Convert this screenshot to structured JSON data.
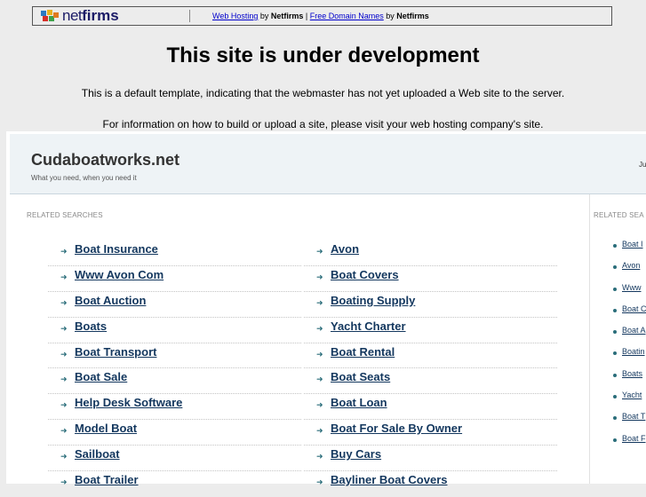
{
  "banner": {
    "logo_text_a": "net",
    "logo_text_b": "firms",
    "links": [
      {
        "link": "Web Hosting",
        "by": " by ",
        "brand": "Netfirms"
      },
      {
        "sep": " | "
      },
      {
        "link": "Free Domain Names",
        "by": " by ",
        "brand": "Netfirms"
      }
    ]
  },
  "page": {
    "title": "This site is under development",
    "notice1": "This is a default template, indicating that the webmaster has not yet uploaded a Web site to the server.",
    "notice2": "For information on how to build or upload a site, please visit your web hosting company's site."
  },
  "parked": {
    "site_name": "Cudaboatworks.net",
    "tagline": "What you need, when you need it",
    "header_right": "Ju",
    "related_label": "RELATED SEARCHES",
    "side_label": "RELATED SEA",
    "left_links": [
      "Boat Insurance",
      "Www Avon Com",
      "Boat Auction",
      "Boats",
      "Boat Transport",
      "Boat Sale",
      "Help Desk Software",
      "Model Boat",
      "Sailboat",
      "Boat Trailer"
    ],
    "right_links": [
      "Avon",
      "Boat Covers",
      "Boating Supply",
      "Yacht Charter",
      "Boat Rental",
      "Boat Seats",
      "Boat Loan",
      "Boat For Sale By Owner",
      "Buy Cars",
      "Bayliner Boat Covers"
    ],
    "side_links": [
      "Boat I",
      "Avon",
      "Www",
      "Boat C",
      "Boat A",
      "Boatin",
      "Boats",
      "Yacht",
      "Boat T",
      "Boat F"
    ]
  },
  "colors": {
    "link": "#13375e",
    "arrow": "#2a6d7a",
    "banner_link": "#0000cc"
  }
}
